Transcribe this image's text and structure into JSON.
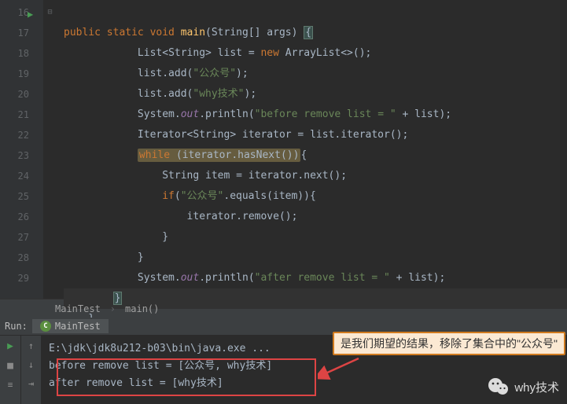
{
  "gutter": {
    "start": 16,
    "end": 29
  },
  "code": {
    "l16": {
      "kw1": "public static void",
      "method": "main",
      "type": "String",
      "param": "[] args)"
    },
    "l17": {
      "type1": "List",
      "generic": "String",
      "var": " list = ",
      "kw": "new",
      "ctor": " ArrayList<>();",
      "indent": "            "
    },
    "l18": {
      "call": "list.add(",
      "str": "\"公众号\"",
      "end": ");"
    },
    "l19": {
      "call": "list.add(",
      "str": "\"why技术\"",
      "end": ");"
    },
    "l20": {
      "obj": "System.",
      "field": "out",
      "dot": ".println(",
      "str": "\"before remove list = \"",
      "plus": " + list);"
    },
    "l21": {
      "type1": "Iterator",
      "generic": "String",
      "rest": "> iterator = list.iterator();"
    },
    "l22": {
      "kw": "while",
      "cond": " (iterator.hasNext())",
      "brace": "{"
    },
    "l23": {
      "text": "String item = iterator.next();"
    },
    "l24": {
      "kw": "if",
      "open": "(",
      "str": "\"公众号\"",
      "rest": ".equals(item)){"
    },
    "l25": {
      "text": "iterator.remove();"
    },
    "l26": {
      "brace": "}"
    },
    "l27": {
      "brace": "}"
    },
    "l28": {
      "obj": "System.",
      "field": "out",
      "dot": ".println(",
      "str": "\"after remove list = \"",
      "plus": " + list);"
    },
    "l29": {
      "brace": "}"
    }
  },
  "breadcrumb": {
    "class": "MainTest",
    "method": "main()"
  },
  "run": {
    "label": "Run:",
    "tab": "MainTest",
    "cmd": "E:\\jdk\\jdk8u212-b03\\bin\\java.exe ...",
    "out1": "before remove list = [公众号, why技术]",
    "out2": "after remove list = [why技术]"
  },
  "callout": "是我们期望的结果，移除了集合中的\"公众号\"",
  "watermark": "why技术"
}
